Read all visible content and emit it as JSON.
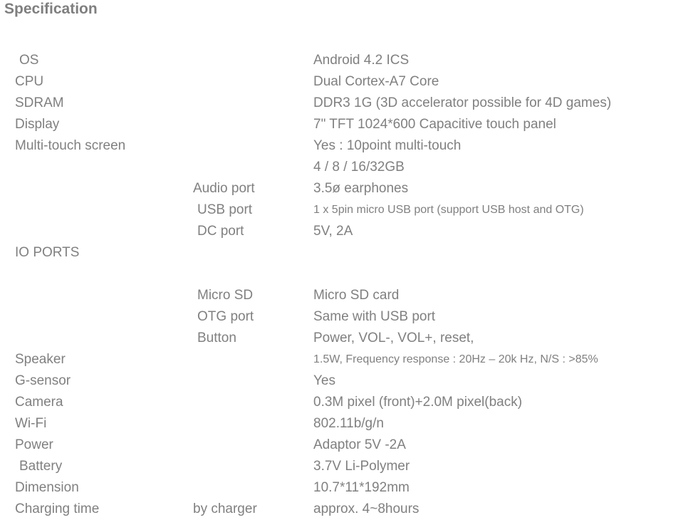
{
  "page": {
    "title": "Specification",
    "text_color": "#808080",
    "background": "#ffffff"
  },
  "table": {
    "rows": [
      {
        "label": "OS",
        "sub": "",
        "value": "Android 4.2 ICS"
      },
      {
        "label": "CPU",
        "sub": "",
        "value": "Dual Cortex-A7 Core"
      },
      {
        "label": "SDRAM",
        "sub": "",
        "value": "DDR3 1G (3D accelerator possible for 4D games)"
      },
      {
        "label": "Display",
        "sub": "",
        "value": "7\" TFT 1024*600 Capacitive touch panel"
      },
      {
        "label": "Multi-touch screen",
        "sub": "",
        "value": "Yes : 10point multi-touch"
      },
      {
        "label": "",
        "sub": "",
        "value": "4 / 8 / 16/32GB"
      },
      {
        "label": "",
        "sub": "Audio port",
        "value": "3.5ø earphones"
      },
      {
        "label": "",
        "sub": "USB port",
        "value": "1 x 5pin micro USB port (support USB host and OTG)"
      },
      {
        "label": "",
        "sub": "DC port",
        "value": "5V, 2A"
      },
      {
        "label": "IO PORTS",
        "sub": "",
        "value": ""
      },
      {
        "label": "",
        "sub": "",
        "value": ""
      },
      {
        "label": "",
        "sub": "Micro SD",
        "value": "Micro SD card"
      },
      {
        "label": "",
        "sub": "OTG port",
        "value": "Same with USB port"
      },
      {
        "label": "",
        "sub": "Button",
        "value": "Power, VOL-, VOL+, reset,"
      },
      {
        "label": "Speaker",
        "sub": "",
        "value": "1.5W, Frequency response : 20Hz – 20k Hz, N/S : >85%"
      },
      {
        "label": "G-sensor",
        "sub": "",
        "value": "Yes"
      },
      {
        "label": "Camera",
        "sub": "",
        "value": "0.3M pixel (front)+2.0M pixel(back)"
      },
      {
        "label": "Wi-Fi",
        "sub": "",
        "value": "802.11b/g/n"
      },
      {
        "label": "Power",
        "sub": "",
        "value": "Adaptor 5V -2A"
      },
      {
        "label": "Battery",
        "sub": "",
        "value": "3.7V Li-Polymer"
      },
      {
        "label": "Dimension",
        "sub": "",
        "value": "10.7*11*192mm"
      },
      {
        "label": "Charging time",
        "sub": "by charger",
        "value": "approx. 4~8hours"
      }
    ]
  }
}
